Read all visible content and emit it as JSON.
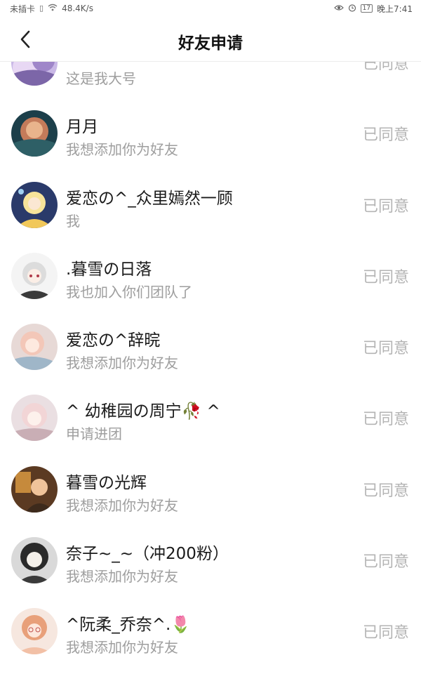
{
  "status_bar": {
    "carrier": "未插卡",
    "net_speed": "48.4K/s",
    "battery": "17",
    "time": "晚上7:41"
  },
  "header": {
    "title": "好友申请"
  },
  "requests": [
    {
      "name": "",
      "message": "这是我大号",
      "status": "已同意"
    },
    {
      "name": "月月",
      "message": "我想添加你为好友",
      "status": "已同意"
    },
    {
      "name": "爱恋の^_众里嫣然一顾",
      "message": "我",
      "status": "已同意"
    },
    {
      "name": ".暮雪の日落",
      "message": "我也加入你们团队了",
      "status": "已同意"
    },
    {
      "name": "爱恋の^辞晥",
      "message": "我想添加你为好友",
      "status": "已同意"
    },
    {
      "name": "^ 幼稚园の周宁🥀 ^",
      "message": "申请进团",
      "status": "已同意"
    },
    {
      "name": "暮雪の光辉",
      "message": "我想添加你为好友",
      "status": "已同意"
    },
    {
      "name": "奈子~_~（冲200粉）",
      "message": "我想添加你为好友",
      "status": "已同意"
    },
    {
      "name": "^阮柔_乔奈^.🌷",
      "message": "我想添加你为好友",
      "status": "已同意"
    }
  ],
  "colors": {
    "name_text": "#1a1a1a",
    "message_text": "#9e9e9e",
    "status_text": "#b4b4b4",
    "divider": "#ececec"
  }
}
